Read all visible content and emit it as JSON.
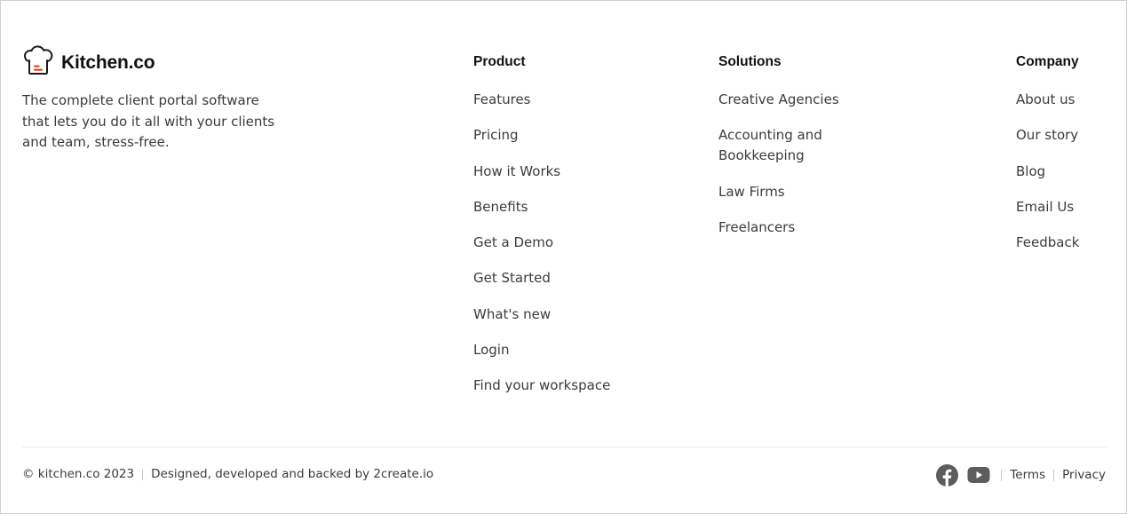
{
  "brand": {
    "name": "Kitchen.co",
    "description": "The complete client portal software that lets you do it all with your clients and team, stress-free.",
    "logo_icon": "chef-hat-icon",
    "accent_color": "#e8431f"
  },
  "columns": {
    "product": {
      "title": "Product",
      "items": [
        "Features",
        "Pricing",
        "How it Works",
        "Benefits",
        "Get a Demo",
        "Get Started",
        "What's new",
        "Login",
        "Find your workspace"
      ]
    },
    "solutions": {
      "title": "Solutions",
      "items": [
        "Creative Agencies",
        "Accounting and Bookkeeping",
        "Law Firms",
        "Freelancers"
      ]
    },
    "company": {
      "title": "Company",
      "items": [
        "About us",
        "Our story",
        "Blog",
        "Email Us",
        "Feedback"
      ]
    }
  },
  "footer": {
    "copyright": "© kitchen.co 2023",
    "credit": "Designed, developed and backed by 2create.io",
    "social": [
      "facebook-icon",
      "youtube-icon"
    ],
    "terms": "Terms",
    "privacy": "Privacy"
  }
}
